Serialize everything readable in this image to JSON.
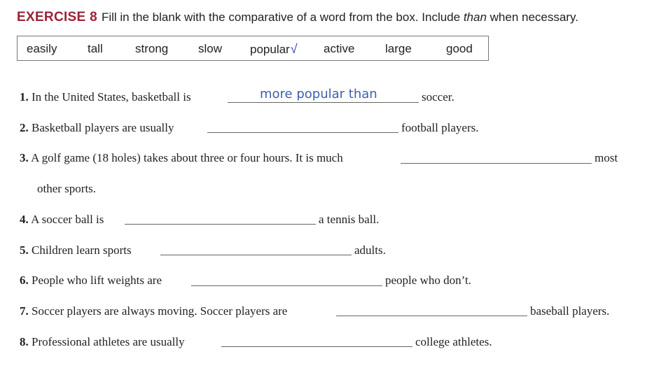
{
  "exercise": {
    "label": "EXERCISE 8",
    "instruction_pre": "Fill in the blank with the comparative of a word from the box. Include ",
    "instruction_em": "than",
    "instruction_post": " when necessary."
  },
  "word_box": [
    "easily",
    "tall",
    "strong",
    "slow",
    "popular",
    "active",
    "large",
    "good"
  ],
  "checkmark": "√",
  "items": [
    {
      "num": "1.",
      "before": "In the United States, basketball is",
      "answer": "more popular than",
      "after": "soccer."
    },
    {
      "num": "2.",
      "before": "Basketball players are usually",
      "answer": "",
      "after": "football players."
    },
    {
      "num": "3.",
      "before": "A golf game (18 holes) takes about three or four hours. It is much",
      "answer": "",
      "after": "most",
      "continuation": "other sports."
    },
    {
      "num": "4.",
      "before": "A soccer ball is",
      "answer": "",
      "after": "a tennis ball."
    },
    {
      "num": "5.",
      "before": "Children learn sports",
      "answer": "",
      "after": "adults."
    },
    {
      "num": "6.",
      "before": "People who lift weights are",
      "answer": "",
      "after": "people who don’t."
    },
    {
      "num": "7.",
      "before": "Soccer players are always moving. Soccer players are",
      "answer": "",
      "after": "baseball players."
    },
    {
      "num": "8.",
      "before": "Professional athletes are usually",
      "answer": "",
      "after": "college athletes."
    }
  ],
  "colors": {
    "exercise_label": "#9b2335",
    "handwriting": "#3b5fae",
    "checkmark": "#2a4c9c"
  }
}
